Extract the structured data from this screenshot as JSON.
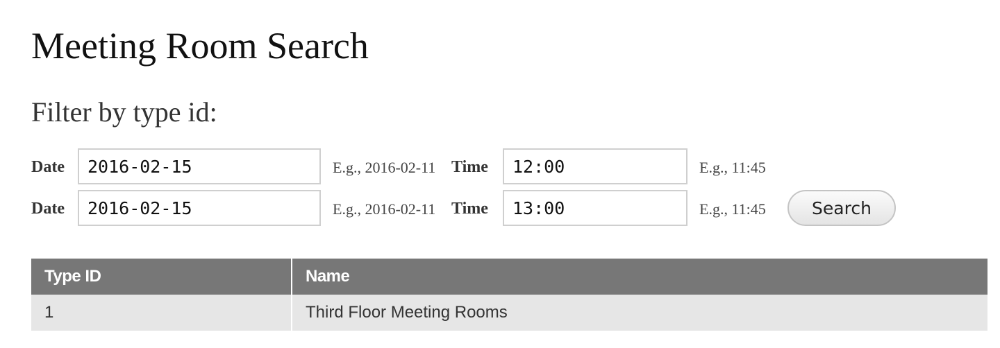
{
  "page": {
    "title": "Meeting Room Search",
    "subtitle": "Filter by type id:"
  },
  "form": {
    "rows": [
      {
        "date_label": "Date",
        "date_value": "2016-02-15",
        "date_hint": "E.g., 2016-02-11",
        "time_label": "Time",
        "time_value": "12:00",
        "time_hint": "E.g., 11:45"
      },
      {
        "date_label": "Date",
        "date_value": "2016-02-15",
        "date_hint": "E.g., 2016-02-11",
        "time_label": "Time",
        "time_value": "13:00",
        "time_hint": "E.g., 11:45"
      }
    ],
    "search_label": "Search"
  },
  "table": {
    "headers": [
      "Type ID",
      "Name"
    ],
    "rows": [
      [
        "1",
        "Third Floor Meeting Rooms"
      ]
    ]
  },
  "colors": {
    "table_header_bg": "#777777",
    "table_row_bg": "#e6e6e6",
    "input_border": "#cfcfcf"
  }
}
